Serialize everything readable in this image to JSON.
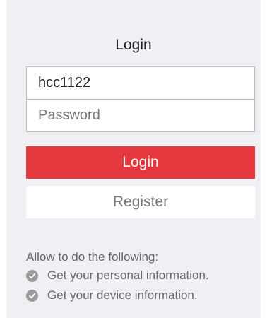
{
  "login_form": {
    "title": "Login",
    "username_value": "hcc1122",
    "password_placeholder": "Password",
    "login_label": "Login",
    "register_label": "Register"
  },
  "permissions": {
    "title": "Allow to do the following:",
    "items": [
      {
        "icon": "check-circle-icon",
        "label": "Get your personal information."
      },
      {
        "icon": "check-circle-icon",
        "label": "Get your device information."
      }
    ]
  },
  "colors": {
    "panel_bg": "#efeff4",
    "primary_button": "#e5383e",
    "check_icon": "#9a9a9a"
  }
}
